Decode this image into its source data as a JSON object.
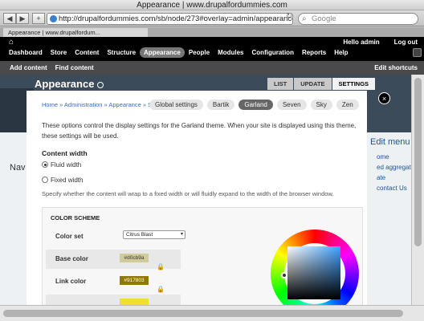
{
  "window": {
    "title": "Appearance | www.drupalfordummies.com"
  },
  "browser": {
    "back_icon": "◀",
    "forward_icon": "▶",
    "add_icon": "+",
    "url": "http://drupalfordummies.com/sb/node/273#overlay=admin/appearance/settings",
    "search_placeholder": "Google",
    "tab_title": "Appearance | www.drupalfordum..."
  },
  "drupal_toolbar": {
    "home_icon": "⌂",
    "menu": [
      "Dashboard",
      "Store",
      "Content",
      "Structure",
      "Appearance",
      "People",
      "Modules",
      "Configuration",
      "Reports",
      "Help"
    ],
    "active": "Appearance",
    "hello": "Hello admin",
    "logout": "Log out"
  },
  "shortcuts": {
    "items": [
      "Add content",
      "Find content"
    ],
    "edit": "Edit shortcuts"
  },
  "page": {
    "title": "Appearance",
    "tabs": [
      "LIST",
      "UPDATE",
      "SETTINGS"
    ],
    "active_tab": "SETTINGS",
    "background": {
      "left_heading": "Nav",
      "right_heading": "Edit menu",
      "right_items": [
        "ome",
        "ed aggregat",
        "ate",
        "contact Us"
      ]
    }
  },
  "overlay": {
    "close_icon": "×",
    "breadcrumb": "Home » Administration » Appearance » Setti",
    "theme_tabs": [
      "Global settings",
      "Bartik",
      "Garland",
      "Seven",
      "Sky",
      "Zen"
    ],
    "active_theme": "Garland",
    "description": "These options control the display settings for the Garland theme. When your site is displayed using this theme, these settings will be used.",
    "content_width": {
      "heading": "Content width",
      "options": [
        "Fluid width",
        "Fixed width"
      ],
      "selected": "Fluid width",
      "help": "Specify whether the content will wrap to a fixed width or will fluidly expand to the width of the browser window."
    },
    "color_scheme": {
      "heading": "COLOR SCHEME",
      "color_set_label": "Color set",
      "color_set_value": "Citrus Blast",
      "base_color_label": "Base color",
      "base_color_value": "#d0cb9a",
      "link_color_label": "Link color",
      "link_color_value": "#917803",
      "lock_icon": "🔒"
    }
  },
  "colors": {
    "drupal_toolbar": "#000000",
    "active_menu": "#777777",
    "link": "#3d6cc0",
    "base_color": "#d0cb9a",
    "link_color": "#917803",
    "third_swatch": "#efdf2e"
  }
}
